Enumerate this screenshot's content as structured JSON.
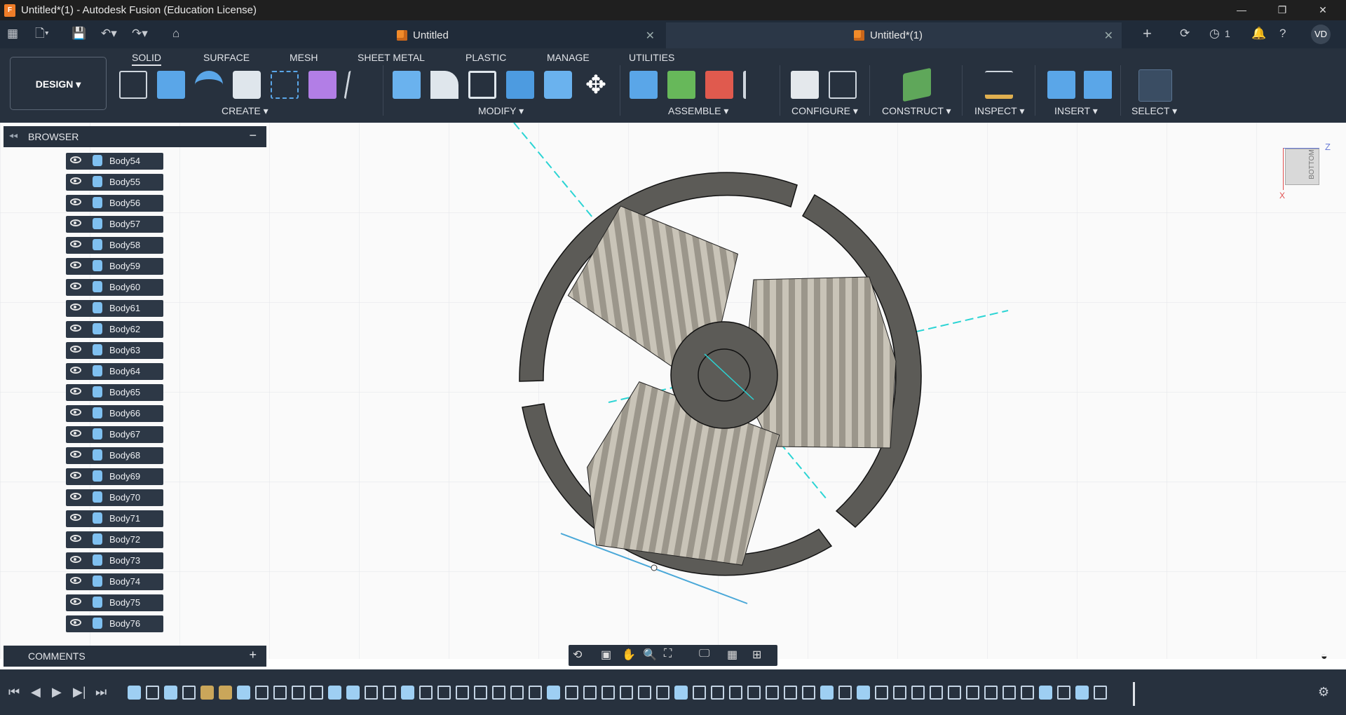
{
  "window": {
    "title": "Untitled*(1) - Autodesk Fusion (Education License)",
    "minimize": "—",
    "restore": "❐",
    "close": "✕"
  },
  "tabs": [
    {
      "label": "Untitled"
    },
    {
      "label": "Untitled*(1)"
    }
  ],
  "header_right": {
    "jobs_count": "1",
    "user_initials": "VD"
  },
  "workspace": {
    "label": "DESIGN ▾"
  },
  "ribbon_tabs": [
    "SOLID",
    "SURFACE",
    "MESH",
    "SHEET METAL",
    "PLASTIC",
    "MANAGE",
    "UTILITIES"
  ],
  "ribbon_groups": [
    "CREATE ▾",
    "MODIFY ▾",
    "ASSEMBLE ▾",
    "CONFIGURE ▾",
    "CONSTRUCT ▾",
    "INSPECT ▾",
    "INSERT ▾",
    "SELECT ▾"
  ],
  "browser": {
    "title": "BROWSER",
    "items": [
      "Body54",
      "Body55",
      "Body56",
      "Body57",
      "Body58",
      "Body59",
      "Body60",
      "Body61",
      "Body62",
      "Body63",
      "Body64",
      "Body65",
      "Body66",
      "Body67",
      "Body68",
      "Body69",
      "Body70",
      "Body71",
      "Body72",
      "Body73",
      "Body74",
      "Body75",
      "Body76"
    ]
  },
  "comments": {
    "title": "COMMENTS",
    "add": "+"
  },
  "viewcube": {
    "face": "BOTTOM",
    "axis_z": "Z",
    "axis_x": "X"
  },
  "colors": {
    "titlebar": "#1f1f1f",
    "toolbar": "#27313e",
    "canvas": "#fafafa",
    "accent": "#f28b2a",
    "body_icon": "#7fc0f0"
  }
}
